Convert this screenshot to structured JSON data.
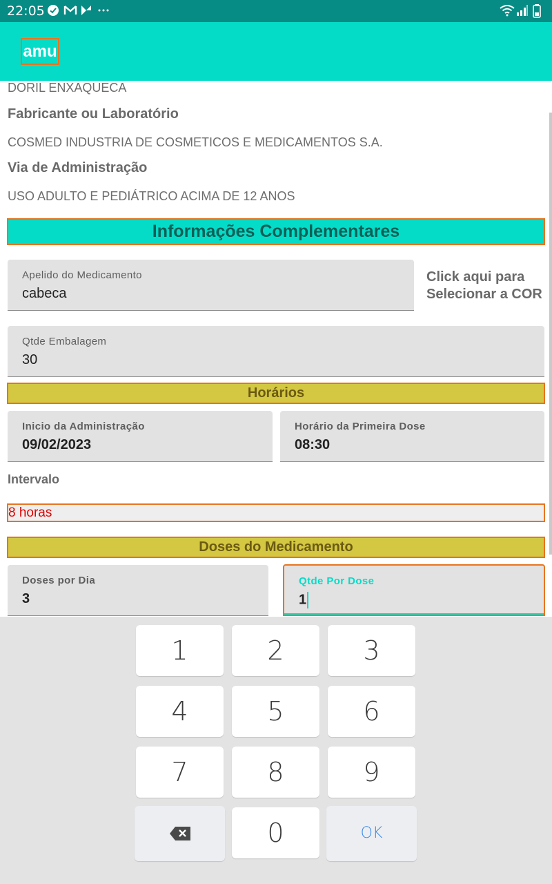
{
  "status_bar": {
    "time": "22:05",
    "icons": [
      "check-circle-icon",
      "gmail-icon",
      "app-icon",
      "more-icon"
    ],
    "right_icons": [
      "wifi-icon",
      "signal-icon",
      "battery-icon"
    ]
  },
  "app_bar": {
    "title": "amu"
  },
  "medication": {
    "name": "DORIL ENXAQUECA",
    "manufacturer_label": "Fabricante ou Laboratório",
    "manufacturer": "COSMED INDUSTRIA DE COSMETICOS E MEDICAMENTOS S.A.",
    "route_label": "Via de Administração",
    "route": "USO ADULTO E PEDIÁTRICO ACIMA DE 12 ANOS"
  },
  "complementary": {
    "header": "Informações Complementares",
    "nickname_label": "Apelido do Medicamento",
    "nickname_value": "cabeca",
    "color_picker_line1": "Click aqui para",
    "color_picker_line2": "Selecionar a COR",
    "package_qty_label": "Qtde Embalagem",
    "package_qty_value": "30"
  },
  "schedule": {
    "header": "Horários",
    "start_label": "Inicio da Administração",
    "start_value": "09/02/2023",
    "first_dose_label": "Horário da Primeira Dose",
    "first_dose_value": "08:30",
    "interval_label": "Intervalo",
    "interval_value": "8 horas"
  },
  "doses": {
    "header": "Doses do Medicamento",
    "per_day_label": "Doses por Dia",
    "per_day_value": "3",
    "per_dose_label": "Qtde Por Dose",
    "per_dose_value": "1"
  },
  "keyboard": {
    "keys": [
      "1",
      "2",
      "3",
      "4",
      "5",
      "6",
      "7",
      "8",
      "9",
      "0"
    ],
    "backspace_icon": "backspace-icon",
    "ok_label": "OK"
  }
}
